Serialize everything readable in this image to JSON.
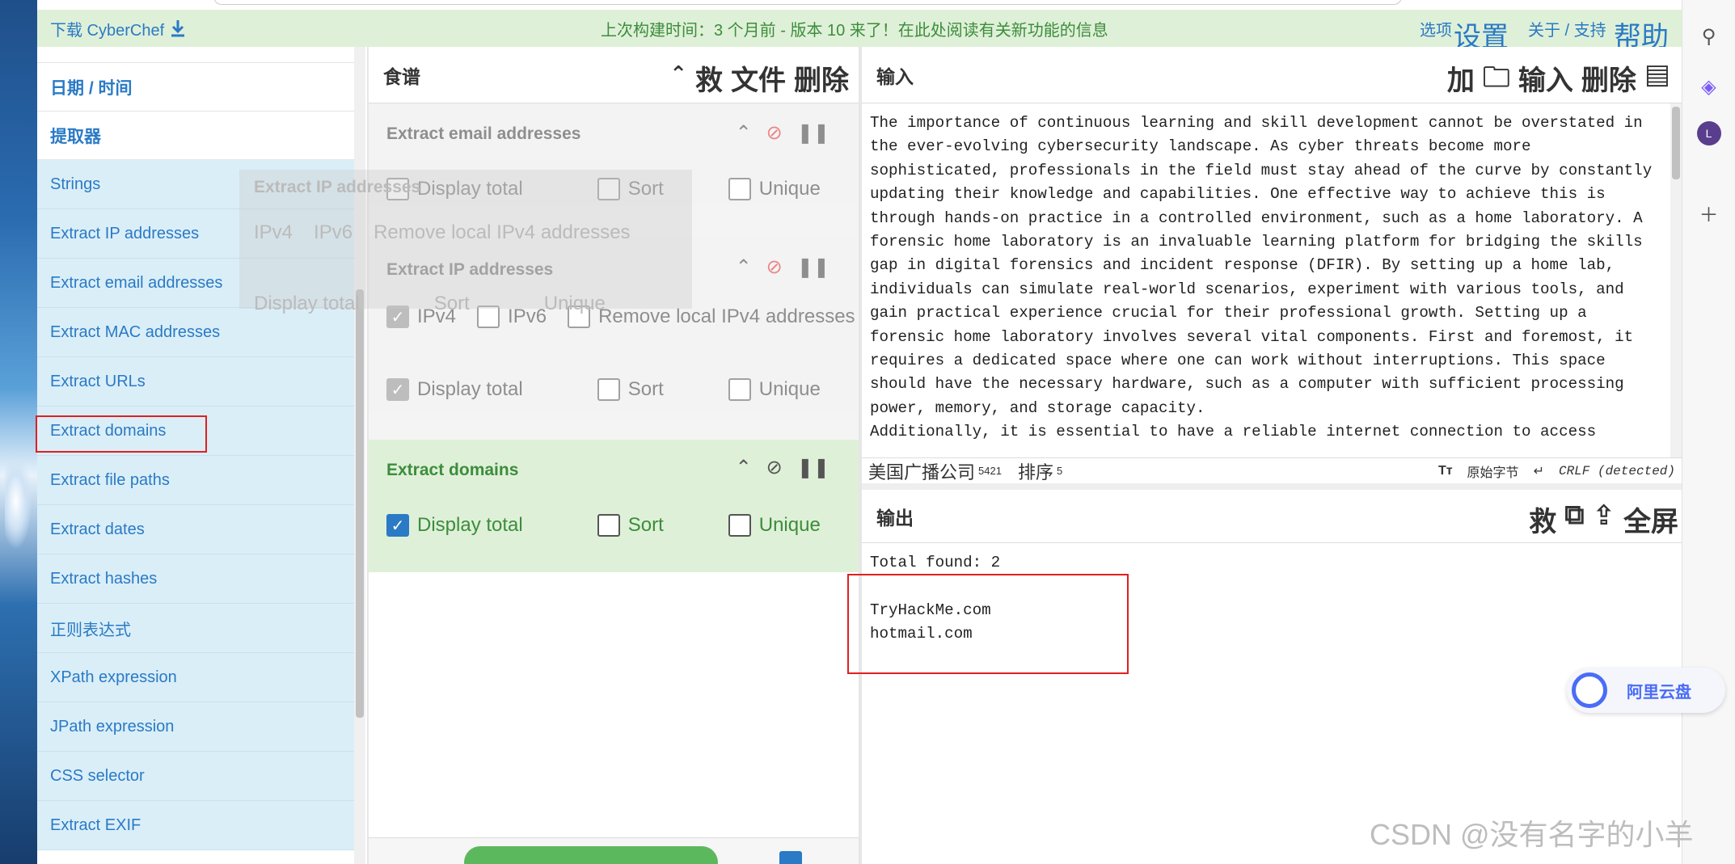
{
  "banner": {
    "download_label": "下载 CyberChef",
    "build_message": "上次构建时间：3 个月前 - 版本 10 来了！在此处阅读有关新功能的信息",
    "options_label": "选项",
    "settings_label": "设置",
    "about_label": "关于 / 支持",
    "help_label": "帮助"
  },
  "operations": {
    "categories": [
      {
        "label": "日期 / 时间"
      },
      {
        "label": "提取器"
      }
    ],
    "items": [
      {
        "label": "Strings"
      },
      {
        "label": "Extract IP addresses"
      },
      {
        "label": "Extract email addresses"
      },
      {
        "label": "Extract MAC addresses"
      },
      {
        "label": "Extract URLs"
      },
      {
        "label": "Extract domains"
      },
      {
        "label": "Extract file paths"
      },
      {
        "label": "Extract dates"
      },
      {
        "label": "Extract hashes"
      },
      {
        "label": "正则表达式"
      },
      {
        "label": "XPath expression"
      },
      {
        "label": "JPath expression"
      },
      {
        "label": "CSS selector"
      },
      {
        "label": "Extract EXIF"
      }
    ]
  },
  "recipe": {
    "title": "食谱",
    "header_tools": [
      "救",
      "文件",
      "删除"
    ],
    "ops": [
      {
        "title": "Extract email addresses",
        "state": "disabled",
        "options": [
          {
            "label": "Display total",
            "checked": false
          },
          {
            "label": "Sort",
            "checked": false
          },
          {
            "label": "Unique",
            "checked": false
          }
        ]
      },
      {
        "title": "Extract IP addresses",
        "state": "disabled",
        "options_row1": [
          {
            "label": "IPv4",
            "checked": true
          },
          {
            "label": "IPv6",
            "checked": false
          },
          {
            "label": "Remove local IPv4 addresses",
            "checked": false
          }
        ],
        "options_row2": [
          {
            "label": "Display total",
            "checked": true
          },
          {
            "label": "Sort",
            "checked": false
          },
          {
            "label": "Unique",
            "checked": false
          }
        ]
      },
      {
        "title": "Extract domains",
        "state": "active",
        "options": [
          {
            "label": "Display total",
            "checked": true
          },
          {
            "label": "Sort",
            "checked": false
          },
          {
            "label": "Unique",
            "checked": false
          }
        ]
      }
    ],
    "drag_ghost": {
      "title": "Extract IP addresses",
      "row1": [
        "IPv4",
        "IPv6",
        "Remove local IPv4 addresses"
      ],
      "row2": [
        "Display total",
        "Sort",
        "Unique"
      ]
    }
  },
  "input": {
    "title": "输入",
    "header_tools": [
      "加",
      "输入",
      "删除"
    ],
    "text": "The importance of continuous learning and skill development cannot be overstated in\nthe ever-evolving cybersecurity landscape. As cyber threats become more\nsophisticated, professionals in the field must stay ahead of the curve by constantly\nupdating their knowledge and capabilities. One effective way to achieve this is\nthrough hands-on practice in a controlled environment, such as a home laboratory. A\nforensic home laboratory is an invaluable learning platform for bridging the skills\ngap in digital forensics and incident response (DFIR). By setting up a home lab,\nindividuals can simulate real-world scenarios, experiment with various tools, and\ngain practical experience crucial for their professional growth. Setting up a\nforensic home laboratory involves several vital components. First and foremost, it\nrequires a dedicated space where one can work without interruptions. This space\nshould have the necessary hardware, such as a computer with sufficient processing\npower, memory, and storage capacity.\nAdditionally, it is essential to have a reliable internet connection to access\nonline resources and collaborate with peers. The next step is to install and",
    "status": {
      "length_label": "美国广播公司",
      "length_value": "5421",
      "lines_label": "排序",
      "lines_value": "5",
      "encoding": "原始字节",
      "eol": "CRLF (detected)"
    }
  },
  "output": {
    "title": "输出",
    "header_tools": [
      "救",
      "复制",
      "替换",
      "全屏"
    ],
    "text": "Total found: 2\n\nTryHackMe.com\nhotmail.com"
  },
  "floating": {
    "cloud_label": "阿里云盘"
  },
  "watermark": "CSDN @没有名字的小羊",
  "colors": {
    "banner_bg": "#dff0d8",
    "ops_bg": "#daeef8",
    "link_blue": "#2a7ac5",
    "active_green": "#3c8d3c",
    "highlight_red": "#e02020"
  }
}
